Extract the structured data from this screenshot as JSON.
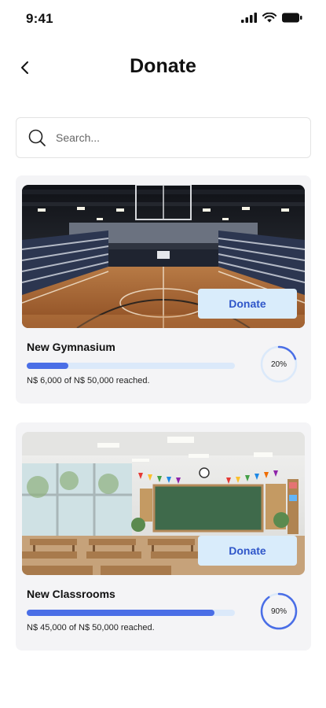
{
  "status_bar": {
    "time": "9:41"
  },
  "header": {
    "title": "Donate"
  },
  "search": {
    "placeholder": "Search..."
  },
  "colors": {
    "accent": "#4a6ee6",
    "track": "#dbe9fa",
    "button_bg": "#d9ecfb",
    "button_text": "#2f56c9"
  },
  "campaigns": [
    {
      "title": "New Gymnasium",
      "button_label": "Donate",
      "raised_text": "N$ 6,000 of N$ 50,000 reached.",
      "percent_label": "20%",
      "progress": 0.2,
      "image": "gymnasium-photo"
    },
    {
      "title": "New Classrooms",
      "button_label": "Donate",
      "raised_text": "N$ 45,000 of N$ 50,000 reached.",
      "percent_label": "90%",
      "progress": 0.9,
      "image": "classroom-photo"
    }
  ]
}
